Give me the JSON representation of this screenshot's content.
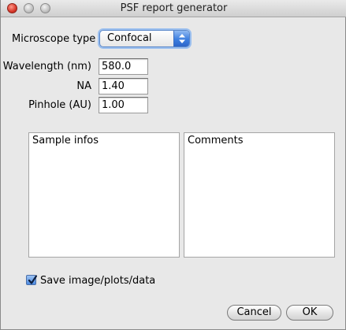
{
  "window": {
    "title": "PSF report generator"
  },
  "form": {
    "microscope_type_label": "Microscope type",
    "microscope_type_value": "Confocal",
    "wavelength_label": "Wavelength (nm)",
    "wavelength_value": "580.0",
    "na_label": "NA",
    "na_value": "1.40",
    "pinhole_label": "Pinhole (AU)",
    "pinhole_value": "1.00"
  },
  "text_areas": {
    "sample_infos": "Sample infos",
    "comments": "Comments"
  },
  "options": {
    "save_label": "Save image/plots/data",
    "save_checked": true
  },
  "buttons": {
    "cancel": "Cancel",
    "ok": "OK"
  },
  "icons": {
    "close": "close-icon",
    "minimize": "minimize-icon",
    "zoom": "zoom-icon",
    "popup_arrows": "chevron-updown-icon",
    "checkmark": "checkmark-icon"
  },
  "colors": {
    "accent": "#3d7fe0",
    "window_bg": "#e8e8e8",
    "close_red": "#d7372a"
  }
}
